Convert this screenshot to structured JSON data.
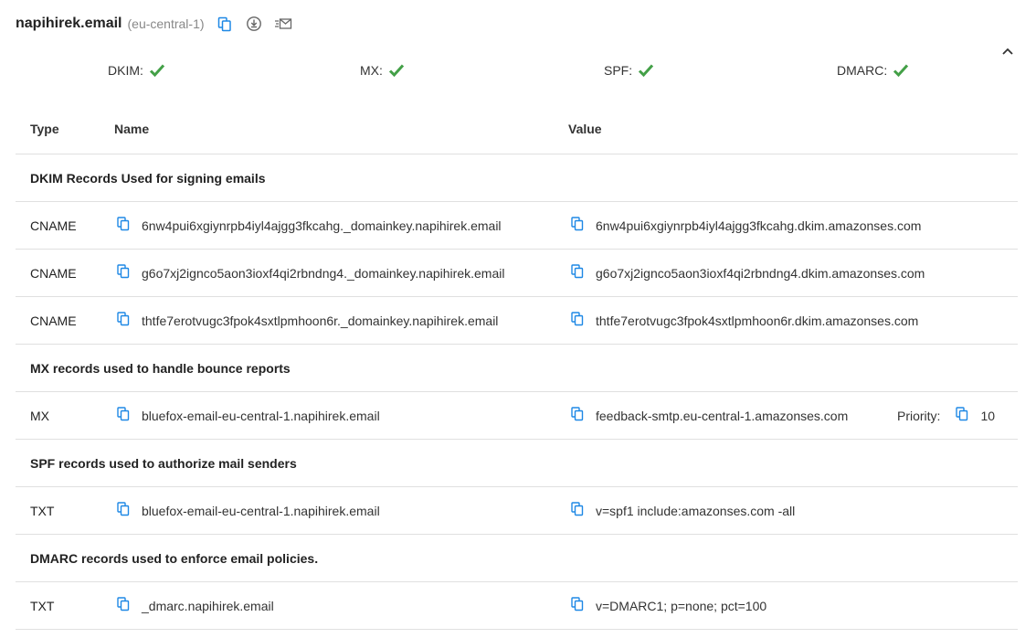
{
  "header": {
    "domain": "napihirek.email",
    "region": "(eu-central-1)",
    "icons": [
      "copy-icon",
      "download-icon",
      "mail-icon"
    ]
  },
  "status": [
    {
      "label": "DKIM:",
      "ok": true
    },
    {
      "label": "MX:",
      "ok": true
    },
    {
      "label": "SPF:",
      "ok": true
    },
    {
      "label": "DMARC:",
      "ok": true
    }
  ],
  "colors": {
    "accent": "#1e88e5",
    "ok": "#43a047",
    "divider": "#e0e0e0"
  },
  "table": {
    "headers": {
      "type": "Type",
      "name": "Name",
      "value": "Value"
    },
    "sections": [
      {
        "title": "DKIM Records Used for signing emails",
        "records": [
          {
            "type": "CNAME",
            "name": "6nw4pui6xgiynrpb4iyl4ajgg3fkcahg._domainkey.napihirek.email",
            "value": "6nw4pui6xgiynrpb4iyl4ajgg3fkcahg.dkim.amazonses.com"
          },
          {
            "type": "CNAME",
            "name": "g6o7xj2ignco5aon3ioxf4qi2rbndng4._domainkey.napihirek.email",
            "value": "g6o7xj2ignco5aon3ioxf4qi2rbndng4.dkim.amazonses.com"
          },
          {
            "type": "CNAME",
            "name": "thtfe7erotvugc3fpok4sxtlpmhoon6r._domainkey.napihirek.email",
            "value": "thtfe7erotvugc3fpok4sxtlpmhoon6r.dkim.amazonses.com"
          }
        ]
      },
      {
        "title": "MX records used to handle bounce reports",
        "records": [
          {
            "type": "MX",
            "name": "bluefox-email-eu-central-1.napihirek.email",
            "value": "feedback-smtp.eu-central-1.amazonses.com",
            "priority_label": "Priority:",
            "priority": "10"
          }
        ]
      },
      {
        "title": "SPF records used to authorize mail senders",
        "records": [
          {
            "type": "TXT",
            "name": "bluefox-email-eu-central-1.napihirek.email",
            "value": "v=spf1 include:amazonses.com -all"
          }
        ]
      },
      {
        "title": "DMARC records used to enforce email policies.",
        "records": [
          {
            "type": "TXT",
            "name": "_dmarc.napihirek.email",
            "value": "v=DMARC1; p=none; pct=100"
          }
        ]
      }
    ]
  }
}
